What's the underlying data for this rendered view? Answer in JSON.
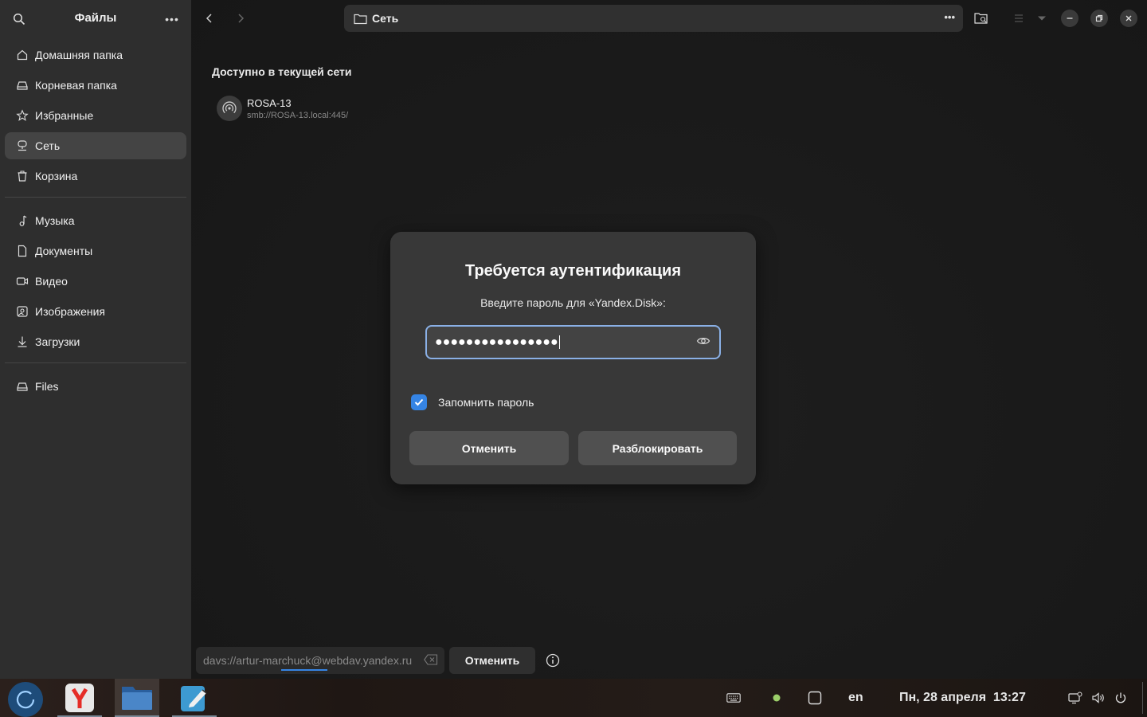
{
  "sidebar": {
    "title": "Файлы",
    "places": [
      {
        "label": "Домашняя папка",
        "icon": "home-icon"
      },
      {
        "label": "Корневая папка",
        "icon": "drive-icon"
      },
      {
        "label": "Избранные",
        "icon": "star-icon"
      },
      {
        "label": "Сеть",
        "icon": "network-icon",
        "active": true
      },
      {
        "label": "Корзина",
        "icon": "trash-icon"
      }
    ],
    "folders": [
      {
        "label": "Музыка",
        "icon": "music-icon"
      },
      {
        "label": "Документы",
        "icon": "document-icon"
      },
      {
        "label": "Видео",
        "icon": "video-icon"
      },
      {
        "label": "Изображения",
        "icon": "image-icon"
      },
      {
        "label": "Загрузки",
        "icon": "download-icon"
      }
    ],
    "mounts": [
      {
        "label": "Files",
        "icon": "drive-icon"
      }
    ]
  },
  "pathbar": {
    "location": "Сеть"
  },
  "content": {
    "section_title": "Доступно в текущей сети",
    "items": [
      {
        "name": "ROSA-13",
        "uri": "smb://ROSA-13.local:445/"
      }
    ]
  },
  "dialog": {
    "title": "Требуется аутентификация",
    "subtitle": "Введите пароль для «Yandex.Disk»:",
    "password_masked": "●●●●●●●●●●●●●●●●",
    "remember_label": "Запомнить пароль",
    "remember_checked": true,
    "cancel_label": "Отменить",
    "unlock_label": "Разблокировать"
  },
  "bottom": {
    "url": "davs://artur-marchuck@webdav.yandex.ru",
    "cancel_label": "Отменить"
  },
  "taskbar": {
    "apps": [
      "yandex-browser-icon",
      "files-icon",
      "text-editor-icon"
    ],
    "language": "en",
    "datetime": "Пн, 28 апреля  13:27"
  },
  "colors": {
    "accent": "#3584e4",
    "sidebar_bg": "#2e2e2e",
    "dialog_bg": "#383838"
  }
}
